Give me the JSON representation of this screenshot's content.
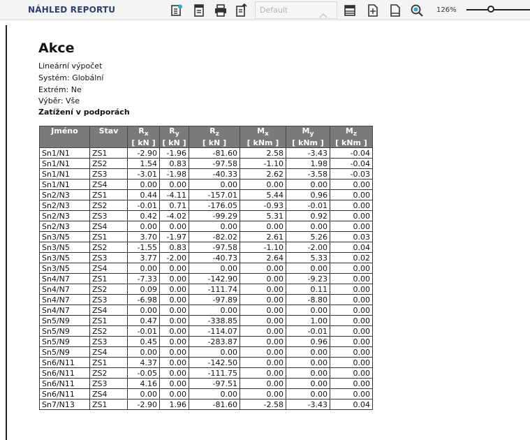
{
  "toolbar": {
    "title": "NÁHLED REPORTU",
    "style_combo": {
      "value": "Default"
    },
    "zoom": "126%",
    "zoom_slider_value": 0.35,
    "icons": [
      "report-settings-icon",
      "report-sheet-icon",
      "print-icon",
      "export-icon",
      "layout-icon",
      "page-setup-icon",
      "page-icon",
      "zoom-icon"
    ]
  },
  "report": {
    "title": "Akce",
    "info_lines": [
      "Lineární  výpočet",
      "Systém:  Globální",
      "Extrém:  Ne",
      "Výběr:  Vše"
    ],
    "section_title": "Zatížení  v podporách",
    "table": {
      "headers": [
        {
          "label": "Jméno",
          "sub": "",
          "unit": ""
        },
        {
          "label": "Stav",
          "sub": "",
          "unit": ""
        },
        {
          "label": "R",
          "sub": "x",
          "unit": "[ kN ]"
        },
        {
          "label": "R",
          "sub": "y",
          "unit": "[ kN ]"
        },
        {
          "label": "R",
          "sub": "z",
          "unit": "[ kN ]"
        },
        {
          "label": "M",
          "sub": "x",
          "unit": "[ kNm ]"
        },
        {
          "label": "M",
          "sub": "y",
          "unit": "[ kNm ]"
        },
        {
          "label": "M",
          "sub": "z",
          "unit": "[ kNm ]"
        }
      ],
      "rows": [
        [
          "Sn1/N1",
          "ZS1",
          "-2.90",
          "-1.96",
          "-81.60",
          "2.58",
          "-3.43",
          "-0.04"
        ],
        [
          "Sn1/N1",
          "ZS2",
          "1.54",
          "0.83",
          "-97.58",
          "-1.10",
          "1.98",
          "-0.04"
        ],
        [
          "Sn1/N1",
          "ZS3",
          "-3.01",
          "-1.98",
          "-40.33",
          "2.62",
          "-3.58",
          "-0.03"
        ],
        [
          "Sn1/N1",
          "ZS4",
          "0.00",
          "0.00",
          "0.00",
          "0.00",
          "0.00",
          "0.00"
        ],
        [
          "Sn2/N3",
          "ZS1",
          "0.44",
          "-4.11",
          "-157.01",
          "5.44",
          "0.96",
          "0.00"
        ],
        [
          "Sn2/N3",
          "ZS2",
          "-0.01",
          "0.71",
          "-176.05",
          "-0.93",
          "-0.01",
          "0.00"
        ],
        [
          "Sn2/N3",
          "ZS3",
          "0.42",
          "-4.02",
          "-99.29",
          "5.31",
          "0.92",
          "0.00"
        ],
        [
          "Sn2/N3",
          "ZS4",
          "0.00",
          "0.00",
          "0.00",
          "0.00",
          "0.00",
          "0.00"
        ],
        [
          "Sn3/N5",
          "ZS1",
          "3.70",
          "-1.97",
          "-82.02",
          "2.61",
          "5.26",
          "0.03"
        ],
        [
          "Sn3/N5",
          "ZS2",
          "-1.55",
          "0.83",
          "-97.58",
          "-1.10",
          "-2.00",
          "0.04"
        ],
        [
          "Sn3/N5",
          "ZS3",
          "3.77",
          "-2.00",
          "-40.73",
          "2.64",
          "5.33",
          "0.02"
        ],
        [
          "Sn3/N5",
          "ZS4",
          "0.00",
          "0.00",
          "0.00",
          "0.00",
          "0.00",
          "0.00"
        ],
        [
          "Sn4/N7",
          "ZS1",
          "-7.33",
          "0.00",
          "-142.90",
          "0.00",
          "-9.23",
          "0.00"
        ],
        [
          "Sn4/N7",
          "ZS2",
          "0.09",
          "0.00",
          "-111.74",
          "0.00",
          "0.11",
          "0.00"
        ],
        [
          "Sn4/N7",
          "ZS3",
          "-6.98",
          "0.00",
          "-97.89",
          "0.00",
          "-8.80",
          "0.00"
        ],
        [
          "Sn4/N7",
          "ZS4",
          "0.00",
          "0.00",
          "0.00",
          "0.00",
          "0.00",
          "0.00"
        ],
        [
          "Sn5/N9",
          "ZS1",
          "0.47",
          "0.00",
          "-338.85",
          "0.00",
          "1.00",
          "0.00"
        ],
        [
          "Sn5/N9",
          "ZS2",
          "-0.01",
          "0.00",
          "-114.07",
          "0.00",
          "-0.01",
          "0.00"
        ],
        [
          "Sn5/N9",
          "ZS3",
          "0.45",
          "0.00",
          "-283.87",
          "0.00",
          "0.96",
          "0.00"
        ],
        [
          "Sn5/N9",
          "ZS4",
          "0.00",
          "0.00",
          "0.00",
          "0.00",
          "0.00",
          "0.00"
        ],
        [
          "Sn6/N11",
          "ZS1",
          "4.37",
          "0.00",
          "-142.50",
          "0.00",
          "0.00",
          "0.00"
        ],
        [
          "Sn6/N11",
          "ZS2",
          "-0.05",
          "0.00",
          "-111.75",
          "0.00",
          "0.00",
          "0.00"
        ],
        [
          "Sn6/N11",
          "ZS3",
          "4.16",
          "0.00",
          "-97.51",
          "0.00",
          "0.00",
          "0.00"
        ],
        [
          "Sn6/N11",
          "ZS4",
          "0.00",
          "0.00",
          "0.00",
          "0.00",
          "0.00",
          "0.00"
        ],
        [
          "Sn7/N13",
          "ZS1",
          "-2.90",
          "1.96",
          "-81.60",
          "-2.58",
          "-3.43",
          "0.04"
        ]
      ]
    }
  },
  "colors": {
    "header_bg": "#7a7a7a",
    "title_text": "#2f3f6e",
    "accent_icon": "#3aa6c9"
  }
}
